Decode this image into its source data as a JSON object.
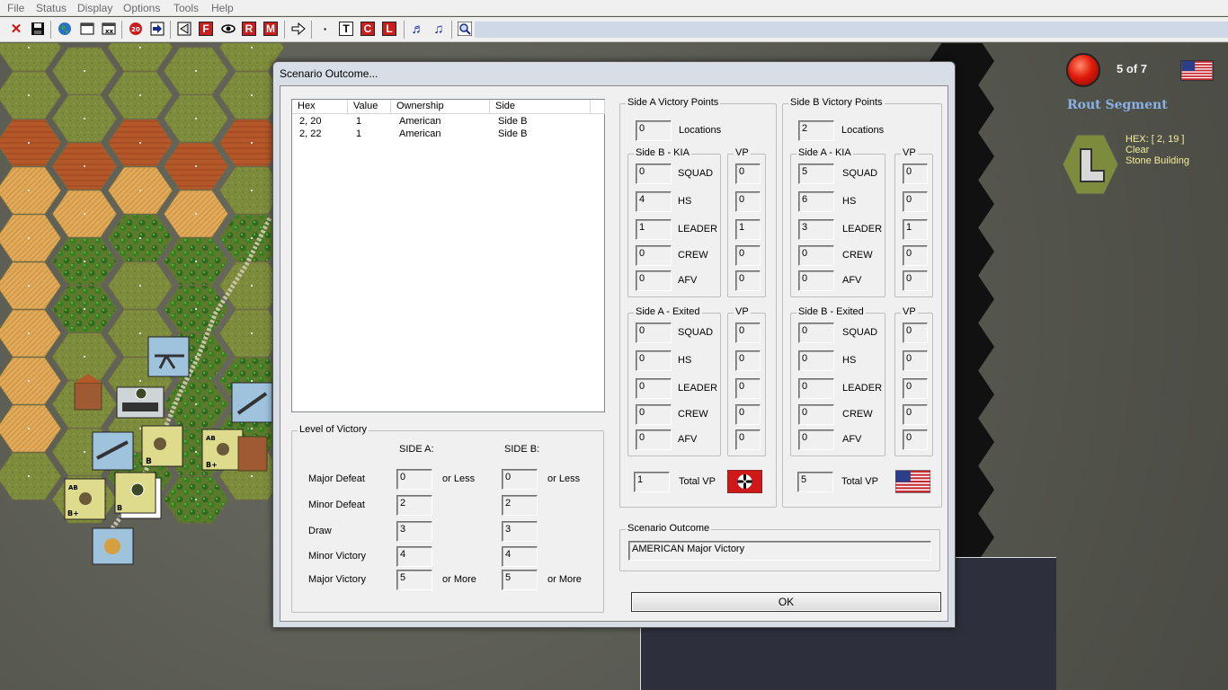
{
  "menu": {
    "items": [
      "File",
      "Status",
      "Display",
      "Options",
      "Tools",
      "Help"
    ]
  },
  "toolbar": {
    "buttons": [
      {
        "icon": "close-icon",
        "glyph": "✕"
      },
      {
        "icon": "save-icon",
        "glyph": ""
      },
      {
        "icon": "globe-icon",
        "glyph": ""
      },
      {
        "icon": "window-icon",
        "glyph": ""
      },
      {
        "icon": "window-icon",
        "glyph": ""
      },
      {
        "icon": "stop-icon",
        "glyph": ""
      },
      {
        "icon": "next-arrow-icon",
        "glyph": "➜"
      },
      {
        "icon": "back-triangle-icon",
        "glyph": "◀"
      },
      {
        "icon": "f-icon",
        "glyph": "F"
      },
      {
        "icon": "eye-icon",
        "glyph": "👁"
      },
      {
        "icon": "r-icon",
        "glyph": "R"
      },
      {
        "icon": "m-icon",
        "glyph": "M"
      },
      {
        "icon": "forward-arrow-icon",
        "glyph": "⇨"
      },
      {
        "icon": "dot-icon",
        "glyph": "·"
      },
      {
        "icon": "t-icon",
        "glyph": "T"
      },
      {
        "icon": "c-icon",
        "glyph": "C"
      },
      {
        "icon": "l-icon",
        "glyph": "L"
      },
      {
        "icon": "sound-fx-icon",
        "glyph": "♫"
      },
      {
        "icon": "music-icon",
        "glyph": "♫"
      },
      {
        "icon": "magnifier-icon",
        "glyph": "🔍"
      }
    ]
  },
  "info_panel": {
    "turn": "5 of 7",
    "phase": "Rout Segment",
    "hex_coord": "HEX: [ 2, 19 ]",
    "hex_terrain": "Clear",
    "hex_building": "Stone Building",
    "colors": {
      "phase": "#8ab2e6",
      "hex_info": "#f3ee9a"
    }
  },
  "dialog": {
    "title": "Scenario Outcome...",
    "list": {
      "headers": [
        "Hex",
        "Value",
        "Ownership",
        "Side"
      ],
      "rows": [
        [
          "2, 20",
          "1",
          "American",
          "Side B"
        ],
        [
          "2, 22",
          "1",
          "American",
          "Side B"
        ]
      ]
    },
    "level_of_victory": {
      "title": "Level of Victory",
      "side_a_header": "SIDE A:",
      "side_b_header": "SIDE B:",
      "rows": [
        {
          "label": "Major Defeat",
          "a": "0",
          "a_suffix": "or Less",
          "b": "0",
          "b_suffix": "or Less"
        },
        {
          "label": "Minor Defeat",
          "a": "2",
          "a_suffix": "",
          "b": "2",
          "b_suffix": ""
        },
        {
          "label": "Draw",
          "a": "3",
          "a_suffix": "",
          "b": "3",
          "b_suffix": ""
        },
        {
          "label": "Minor Victory",
          "a": "4",
          "a_suffix": "",
          "b": "4",
          "b_suffix": ""
        },
        {
          "label": "Major Victory",
          "a": "5",
          "a_suffix": "or More",
          "b": "5",
          "b_suffix": "or More"
        }
      ]
    },
    "side_a": {
      "title": "Side A Victory Points",
      "locations_value": "0",
      "locations_label": "Locations",
      "kia_title": "Side B - KIA",
      "kia": [
        {
          "label": "SQUAD",
          "count": "0",
          "vp": "0"
        },
        {
          "label": "HS",
          "count": "4",
          "vp": "0"
        },
        {
          "label": "LEADER",
          "count": "1",
          "vp": "1"
        },
        {
          "label": "CREW",
          "count": "0",
          "vp": "0"
        },
        {
          "label": "AFV",
          "count": "0",
          "vp": "0"
        }
      ],
      "exited_title": "Side A - Exited",
      "exited": [
        {
          "label": "SQUAD",
          "count": "0",
          "vp": "0"
        },
        {
          "label": "HS",
          "count": "0",
          "vp": "0"
        },
        {
          "label": "LEADER",
          "count": "0",
          "vp": "0"
        },
        {
          "label": "CREW",
          "count": "0",
          "vp": "0"
        },
        {
          "label": "AFV",
          "count": "0",
          "vp": "0"
        }
      ],
      "vp_header": "VP",
      "total_value": "1",
      "total_label": "Total VP"
    },
    "side_b": {
      "title": "Side B Victory Points",
      "locations_value": "2",
      "locations_label": "Locations",
      "kia_title": "Side A - KIA",
      "kia": [
        {
          "label": "SQUAD",
          "count": "5",
          "vp": "0"
        },
        {
          "label": "HS",
          "count": "6",
          "vp": "0"
        },
        {
          "label": "LEADER",
          "count": "3",
          "vp": "1"
        },
        {
          "label": "CREW",
          "count": "0",
          "vp": "0"
        },
        {
          "label": "AFV",
          "count": "0",
          "vp": "0"
        }
      ],
      "exited_title": "Side B - Exited",
      "exited": [
        {
          "label": "SQUAD",
          "count": "0",
          "vp": "0"
        },
        {
          "label": "HS",
          "count": "0",
          "vp": "0"
        },
        {
          "label": "LEADER",
          "count": "0",
          "vp": "0"
        },
        {
          "label": "CREW",
          "count": "0",
          "vp": "0"
        },
        {
          "label": "AFV",
          "count": "0",
          "vp": "0"
        }
      ],
      "vp_header": "VP",
      "total_value": "5",
      "total_label": "Total VP"
    },
    "outcome": {
      "title": "Scenario Outcome",
      "value": "AMERICAN Major Victory"
    },
    "ok_label": "OK"
  }
}
